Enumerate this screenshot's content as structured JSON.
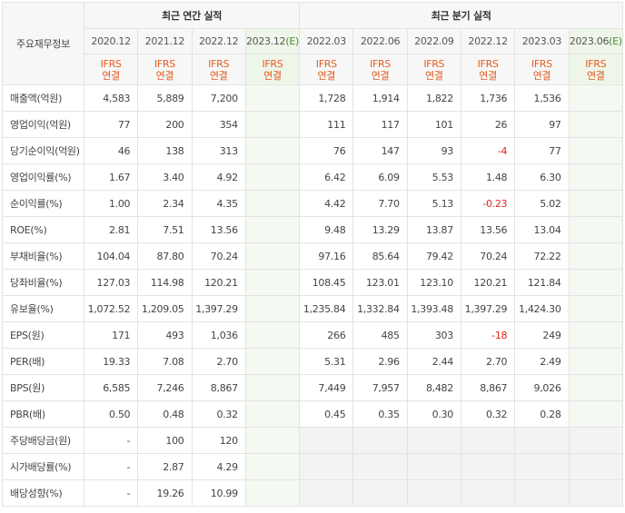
{
  "header": {
    "label_column": "주요재무정보",
    "annual_group": "최근 연간 실적",
    "quarterly_group": "최근 분기 실적"
  },
  "periods": [
    {
      "label": "2020.12",
      "estimate": false
    },
    {
      "label": "2021.12",
      "estimate": false
    },
    {
      "label": "2022.12",
      "estimate": false
    },
    {
      "label": "2023.12(E)",
      "estimate": true
    },
    {
      "label": "2022.03",
      "estimate": false
    },
    {
      "label": "2022.06",
      "estimate": false
    },
    {
      "label": "2022.09",
      "estimate": false
    },
    {
      "label": "2022.12",
      "estimate": false
    },
    {
      "label": "2023.03",
      "estimate": false
    },
    {
      "label": "2023.06(E)",
      "estimate": true
    }
  ],
  "ifrs": {
    "line1": "IFRS",
    "line2": "연결"
  },
  "rows": [
    {
      "label": "매출액(억원)",
      "values": [
        "4,583",
        "5,889",
        "7,200",
        "",
        "1,728",
        "1,914",
        "1,822",
        "1,736",
        "1,536",
        ""
      ]
    },
    {
      "label": "영업이익(억원)",
      "values": [
        "77",
        "200",
        "354",
        "",
        "111",
        "117",
        "101",
        "26",
        "97",
        ""
      ]
    },
    {
      "label": "당기순이익(억원)",
      "values": [
        "46",
        "138",
        "313",
        "",
        "76",
        "147",
        "93",
        "-4",
        "77",
        ""
      ]
    },
    {
      "label": "영업이익률(%)",
      "values": [
        "1.67",
        "3.40",
        "4.92",
        "",
        "6.42",
        "6.09",
        "5.53",
        "1.48",
        "6.30",
        ""
      ]
    },
    {
      "label": "순이익률(%)",
      "values": [
        "1.00",
        "2.34",
        "4.35",
        "",
        "4.42",
        "7.70",
        "5.13",
        "-0.23",
        "5.02",
        ""
      ]
    },
    {
      "label": "ROE(%)",
      "values": [
        "2.81",
        "7.51",
        "13.56",
        "",
        "9.48",
        "13.29",
        "13.87",
        "13.56",
        "13.04",
        ""
      ]
    },
    {
      "label": "부채비율(%)",
      "values": [
        "104.04",
        "87.80",
        "70.24",
        "",
        "97.16",
        "85.64",
        "79.42",
        "70.24",
        "72.22",
        ""
      ]
    },
    {
      "label": "당좌비율(%)",
      "values": [
        "127.03",
        "114.98",
        "120.21",
        "",
        "108.45",
        "123.01",
        "123.10",
        "120.21",
        "121.84",
        ""
      ]
    },
    {
      "label": "유보율(%)",
      "values": [
        "1,072.52",
        "1,209.05",
        "1,397.29",
        "",
        "1,235.84",
        "1,332.84",
        "1,393.48",
        "1,397.29",
        "1,424.30",
        ""
      ]
    },
    {
      "label": "EPS(원)",
      "values": [
        "171",
        "493",
        "1,036",
        "",
        "266",
        "485",
        "303",
        "-18",
        "249",
        ""
      ]
    },
    {
      "label": "PER(배)",
      "values": [
        "19.33",
        "7.08",
        "2.70",
        "",
        "5.31",
        "2.96",
        "2.44",
        "2.70",
        "2.49",
        ""
      ]
    },
    {
      "label": "BPS(원)",
      "values": [
        "6,585",
        "7,246",
        "8,867",
        "",
        "7,449",
        "7,957",
        "8,482",
        "8,867",
        "9,026",
        ""
      ]
    },
    {
      "label": "PBR(배)",
      "values": [
        "0.50",
        "0.48",
        "0.32",
        "",
        "0.45",
        "0.35",
        "0.30",
        "0.32",
        "0.28",
        ""
      ]
    },
    {
      "label": "주당배당금(원)",
      "values": [
        "-",
        "100",
        "120",
        "",
        "",
        "",
        "",
        "",
        "",
        ""
      ]
    },
    {
      "label": "시가배당률(%)",
      "values": [
        "-",
        "2.87",
        "4.29",
        "",
        "",
        "",
        "",
        "",
        "",
        ""
      ]
    },
    {
      "label": "배당성향(%)",
      "values": [
        "-",
        "19.26",
        "10.99",
        "",
        "",
        "",
        "",
        "",
        "",
        ""
      ]
    }
  ],
  "colors": {
    "ifrs_text": "#e35b1d",
    "negative": "#e0261d",
    "estimate_bg": "#f4f9f1",
    "header_bg": "#f7f7f7"
  }
}
